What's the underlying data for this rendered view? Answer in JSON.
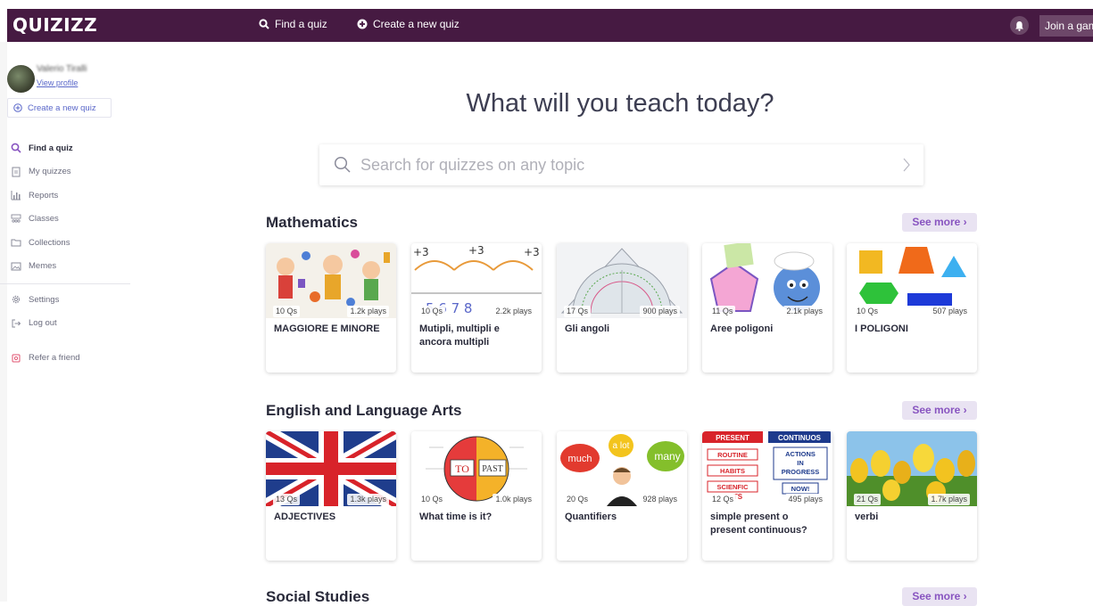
{
  "topbar": {
    "logo": "QUIZIZZ",
    "find_quiz": "Find a quiz",
    "create_quiz": "Create a new quiz",
    "join_game": "Join a game"
  },
  "sidebar": {
    "user_name": "Valerio Tiralli",
    "view_profile": "View profile",
    "create_quiz": "Create a new quiz",
    "items": [
      {
        "label": "Find a quiz",
        "icon": "search-icon"
      },
      {
        "label": "My quizzes",
        "icon": "document-icon"
      },
      {
        "label": "Reports",
        "icon": "chart-icon"
      },
      {
        "label": "Classes",
        "icon": "people-icon"
      },
      {
        "label": "Collections",
        "icon": "folder-icon"
      },
      {
        "label": "Memes",
        "icon": "image-icon"
      },
      {
        "label": "Settings",
        "icon": "gear-icon"
      },
      {
        "label": "Log out",
        "icon": "logout-icon"
      },
      {
        "label": "Refer a friend",
        "icon": "gift-icon"
      }
    ]
  },
  "main": {
    "headline": "What will you teach today?",
    "search_placeholder": "Search for quizzes on any topic",
    "see_more": "See more",
    "sections": [
      {
        "title": "Mathematics",
        "cards": [
          {
            "title": "MAGGIORE E MINORE",
            "qs": "10 Qs",
            "plays": "1.2k plays"
          },
          {
            "title": "Mutipli, multipli e ancora multipli",
            "qs": "10 Qs",
            "plays": "2.2k plays"
          },
          {
            "title": "Gli angoli",
            "qs": "17 Qs",
            "plays": "900 plays"
          },
          {
            "title": "Aree poligoni",
            "qs": "11 Qs",
            "plays": "2.1k plays"
          },
          {
            "title": "I POLIGONI",
            "qs": "10 Qs",
            "plays": "507 plays"
          }
        ]
      },
      {
        "title": "English and Language Arts",
        "cards": [
          {
            "title": "ADJECTIVES",
            "qs": "13 Qs",
            "plays": "1.3k plays"
          },
          {
            "title": "What time is it?",
            "qs": "10 Qs",
            "plays": "1.0k plays"
          },
          {
            "title": "Quantifiers",
            "qs": "20 Qs",
            "plays": "928 plays"
          },
          {
            "title": "simple present o present continuous?",
            "qs": "12 Qs",
            "plays": "495 plays"
          },
          {
            "title": "verbi",
            "qs": "21 Qs",
            "plays": "1.7k plays"
          }
        ]
      },
      {
        "title": "Social Studies",
        "cards": []
      }
    ],
    "thumb_text": {
      "plus3": "+3",
      "numbers": "5  6  7  8",
      "topast_to": "TO",
      "topast_past": "PAST",
      "much": "much",
      "alot": "a lot",
      "many": "many",
      "present": "PRESENT",
      "continuos": "CONTINUOS",
      "routine": "ROUTINE",
      "habits": "HABITS",
      "scienfic": "SCIENFIC",
      "ts": "TS",
      "actions": "ACTIONS",
      "in": "IN",
      "progress": "PROGRESS",
      "now": "NOW!"
    }
  }
}
